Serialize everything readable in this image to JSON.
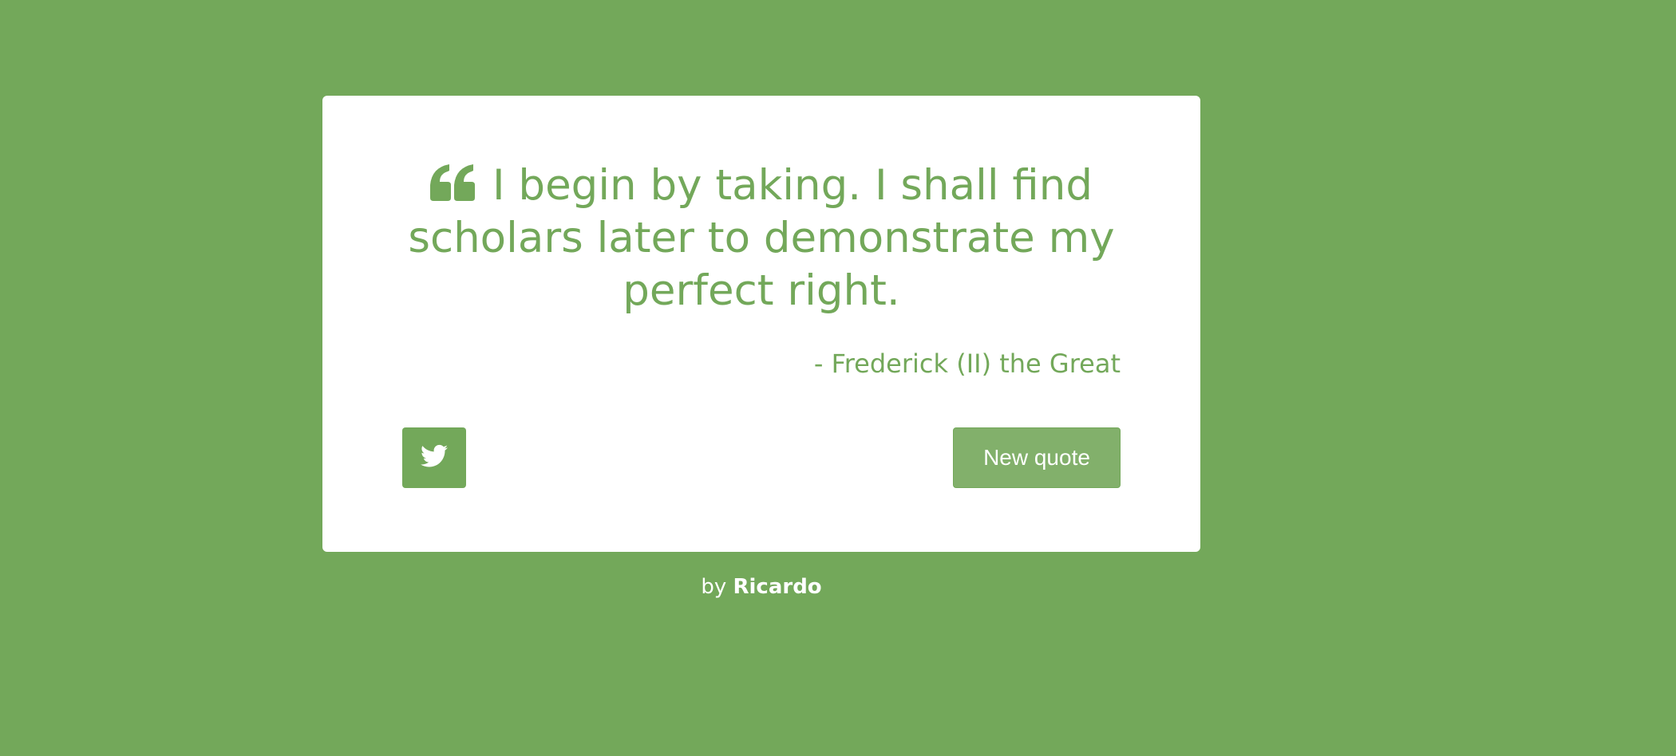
{
  "colors": {
    "background": "#73a85a",
    "card": "#ffffff",
    "accent": "#73a85a",
    "button": "#82b06b",
    "button_text": "#ffffff"
  },
  "quote": {
    "icon": "quote-left-icon",
    "text": "I begin by taking. I shall find scholars later to demonstrate my perfect right.",
    "author": "- Frederick (II) the Great"
  },
  "actions": {
    "tweet_icon": "twitter-icon",
    "new_quote_label": "New quote"
  },
  "footer": {
    "prefix": "by",
    "name": "Ricardo"
  }
}
